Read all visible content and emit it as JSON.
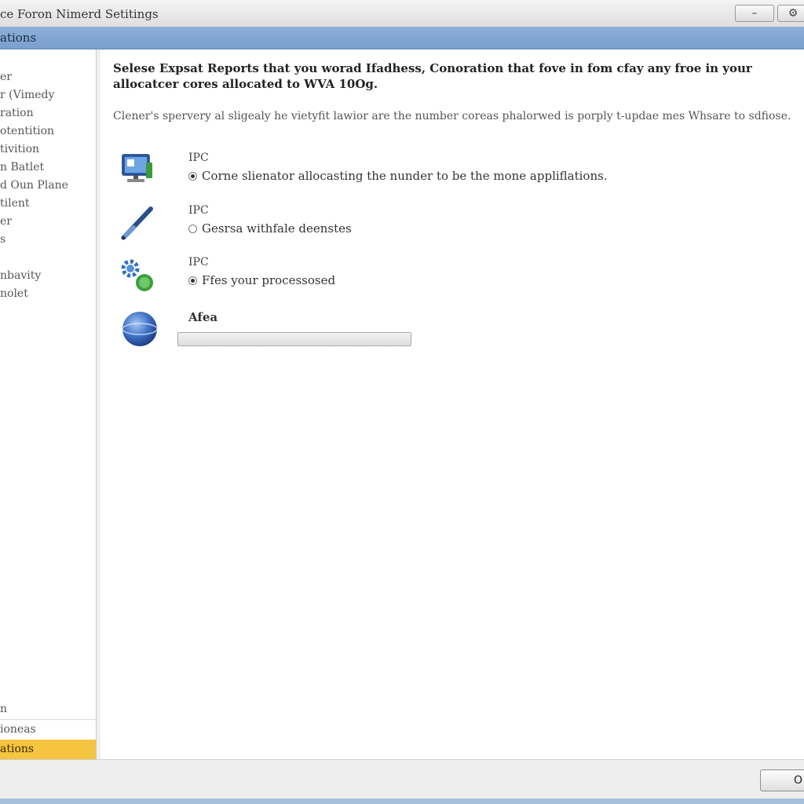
{
  "window": {
    "title": "ce Foron Nimerd Setitings",
    "minimize_label": "–",
    "close_label": "⚙"
  },
  "header": {
    "title": "ations"
  },
  "sidebar": {
    "items": [
      {
        "label": "er"
      },
      {
        "label": "r (Vimedy"
      },
      {
        "label": "ration"
      },
      {
        "label": "otentition"
      },
      {
        "label": "tivition"
      },
      {
        "label": "n Batlet"
      },
      {
        "label": "d Oun Plane"
      },
      {
        "label": "tilent"
      },
      {
        "label": "er"
      },
      {
        "label": "s"
      },
      {
        "label": ""
      },
      {
        "label": "nbavity"
      },
      {
        "label": "nolet"
      }
    ],
    "bottom_items": [
      {
        "label": "n"
      },
      {
        "label": "ioneas"
      },
      {
        "label": "ations"
      }
    ]
  },
  "main": {
    "heading": "Selese Expsat Reports that you worad Ifadhess, Conoration that fove in fom cfay any froe in your allocatcer cores allocated to WVA 10Og.",
    "description": "Clener's spervery al sligealy he vietyfit lawior are the number coreas phalorwed is porply t-updae mes Whsare to sdfiose.",
    "options": [
      {
        "label": "IPC",
        "text": "Corne slienator allocasting the nunder to be the mone appliflations.",
        "checked": true,
        "icon": "monitor-icon"
      },
      {
        "label": "IPC",
        "text": "Gesrsa withfale deenstes",
        "checked": false,
        "icon": "brush-icon"
      },
      {
        "label": "IPC",
        "text": "Ffes your processosed",
        "checked": true,
        "icon": "gears-icon"
      }
    ],
    "progress_section": {
      "heading": "Afea",
      "progress": 0,
      "icon": "globe-icon"
    }
  },
  "footer": {
    "button_label": "O"
  },
  "colors": {
    "header_bar": "#7a9fce",
    "selected_item": "#f5c440"
  }
}
